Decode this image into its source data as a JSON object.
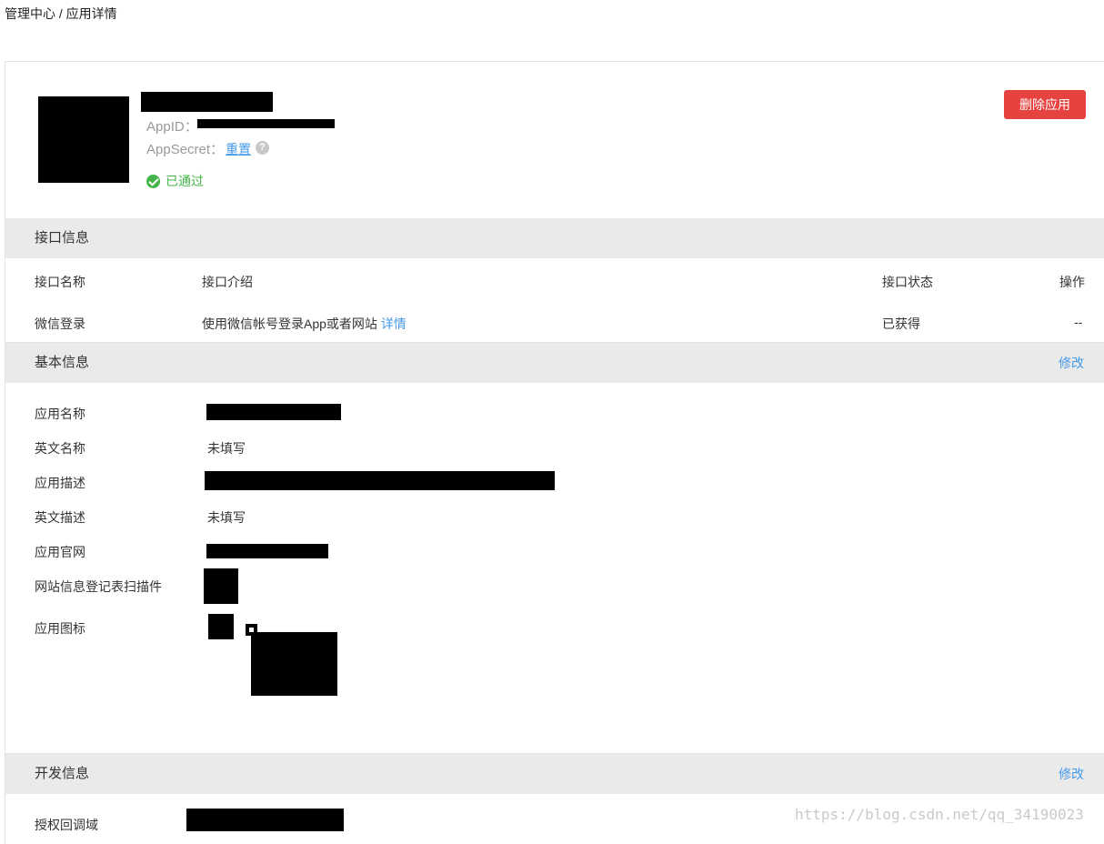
{
  "breadcrumb": {
    "root": "管理中心",
    "separator": " / ",
    "current": "应用详情"
  },
  "header": {
    "appid_label": "AppID：",
    "appsecret_label": "AppSecret：",
    "reset_link": "重置",
    "help_glyph": "?",
    "status_text": "已通过",
    "delete_button": "删除应用"
  },
  "api_section": {
    "title": "接口信息",
    "columns": [
      "接口名称",
      "接口介绍",
      "接口状态",
      "操作"
    ],
    "rows": [
      {
        "name": "微信登录",
        "intro": "使用微信帐号登录App或者网站",
        "detail_link": "详情",
        "status": "已获得",
        "action": "--"
      }
    ]
  },
  "basic_section": {
    "title": "基本信息",
    "edit": "修改",
    "fields": {
      "app_name": "应用名称",
      "en_name": "英文名称",
      "en_name_value": "未填写",
      "app_desc": "应用描述",
      "en_desc": "英文描述",
      "en_desc_value": "未填写",
      "website": "应用官网",
      "scan_form": "网站信息登记表扫描件",
      "app_icon": "应用图标"
    }
  },
  "dev_section": {
    "title": "开发信息",
    "edit": "修改",
    "callback_label": "授权回调域"
  },
  "watermark": "https://blog.csdn.net/qq_34190023",
  "colors": {
    "accent": "#459ae9",
    "danger": "#e64340",
    "success": "#44b549",
    "section_bg": "#eaeaea"
  }
}
